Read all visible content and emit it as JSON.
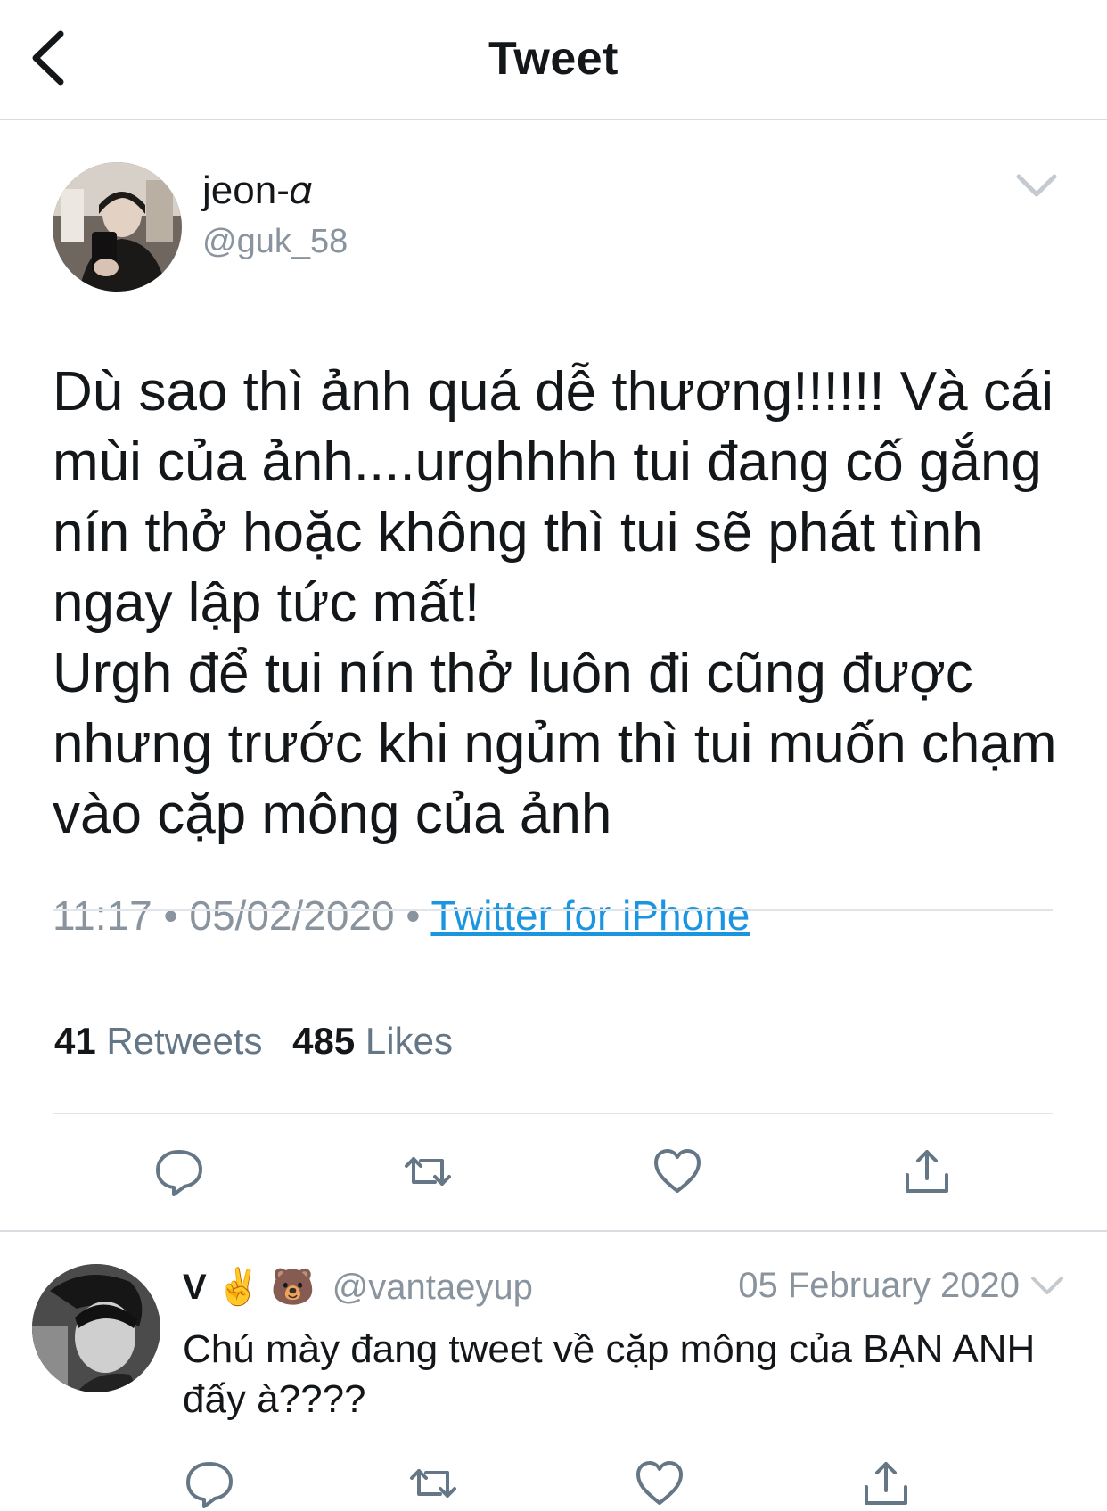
{
  "header": {
    "title": "Tweet",
    "back_icon": "chevron-left-icon"
  },
  "tweet": {
    "display_name": "jeon-𝛼",
    "handle": "@guk_58",
    "text": "Dù sao thì ảnh quá dễ thương!!!!!! Và cái mùi của ảnh....urghhhh tui đang cố gắng nín thở hoặc không thì tui sẽ phát tình ngay lập tức mất!\nUrgh để tui nín thở luôn đi cũng được nhưng trước khi ngủm thì tui muốn chạm vào cặp mông của ảnh",
    "time": "11:17",
    "date": "05/02/2020",
    "separator": "•",
    "source": "Twitter for iPhone",
    "retweets_count": "41",
    "retweets_label": "Retweets",
    "likes_count": "485",
    "likes_label": "Likes"
  },
  "reply": {
    "display_name": "V ✌️ 🐻",
    "handle": "@vantaeyup",
    "date": "05 February 2020",
    "text": "Chú mày đang tweet về cặp mông của BẠN ANH đấy à????"
  },
  "colors": {
    "accent_link": "#1b95e0",
    "secondary_text": "#8a949e",
    "icon_gray": "#657786",
    "divider": "#e1e4e8"
  }
}
